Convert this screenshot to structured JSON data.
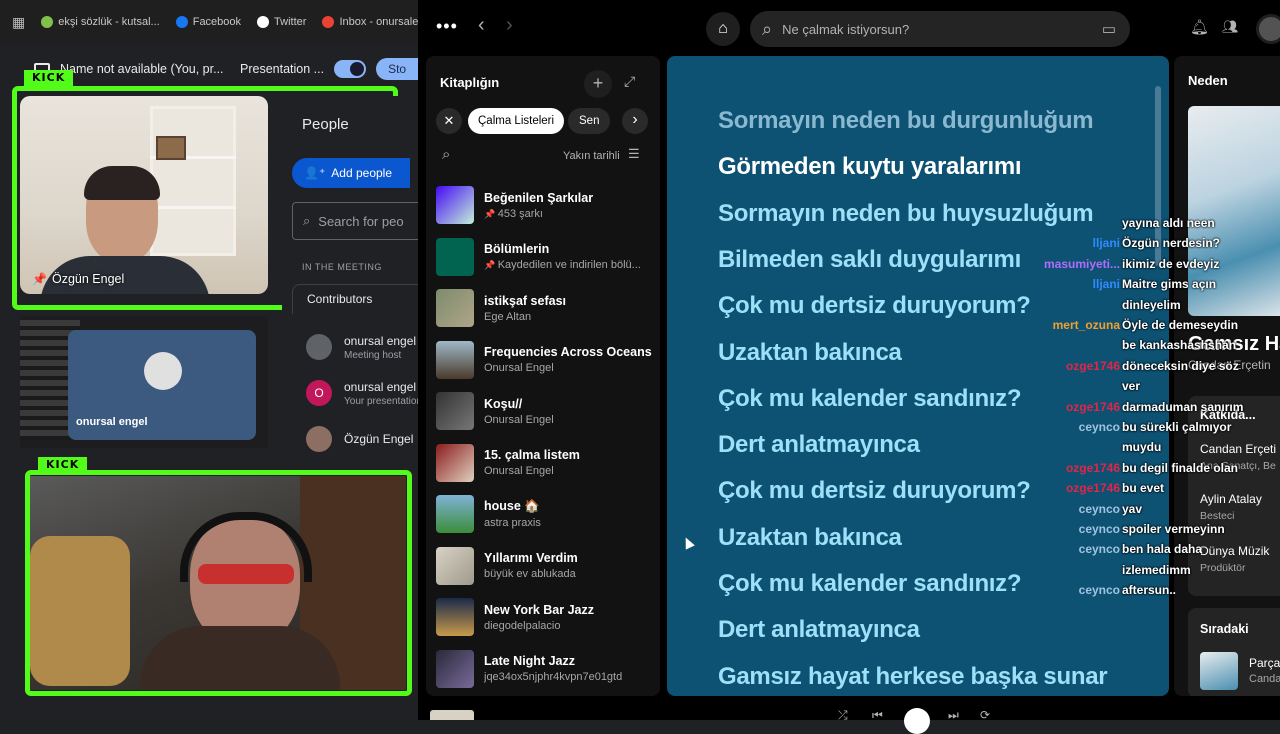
{
  "bookmarks": [
    {
      "label": "ekşi sözlük - kutsal...",
      "color": "#81c14b"
    },
    {
      "label": "Facebook",
      "color": "#1877f2"
    },
    {
      "label": "Twitter",
      "color": "#ffffff"
    },
    {
      "label": "Inbox - onursalenge...",
      "color": "#ea4335"
    }
  ],
  "meet": {
    "presenter_text": "Name not available (You, pr...",
    "presentation_label": "Presentation ...",
    "stop_label": "Sto",
    "kick_label": "KICK",
    "cam1_name": "Özgün Engel",
    "people_title": "People",
    "add_people": "Add people",
    "search_placeholder": "Search for peo",
    "in_meeting": "IN THE MEETING",
    "contributors": "Contributors",
    "participants": [
      {
        "name": "onursal engel",
        "role": "Meeting host",
        "avatar_color": "#5f6368"
      },
      {
        "name": "onursal engel",
        "role": "Your presentation",
        "avatar_color": "#c2185b",
        "initial": "O"
      },
      {
        "name": "Özgün Engel",
        "role": "",
        "avatar_color": "#8d6e63"
      }
    ],
    "tile_name": "onursal engel"
  },
  "spotify": {
    "search_placeholder": "Ne çalmak istiyorsun?",
    "library_title": "Kitaplığın",
    "filters": [
      "Çalma Listeleri",
      "Sen"
    ],
    "sort_label": "Yakın tarihli",
    "items": [
      {
        "title": "Beğenilen Şarkılar",
        "sub": "453 şarkı",
        "pinned": true,
        "thumb": "linear-gradient(135deg,#450af5,#c4efd9)"
      },
      {
        "title": "Bölümlerin",
        "sub": "Kaydedilen ve indirilen bölü...",
        "pinned": true,
        "thumb": "#006450"
      },
      {
        "title": "istikşaf sefası",
        "sub": "Ege Altan",
        "pinned": false,
        "thumb": "linear-gradient(135deg,#7d8c6b,#b0a58a)"
      },
      {
        "title": "Frequencies Across Oceans",
        "sub": "Onursal Engel",
        "pinned": false,
        "thumb": "linear-gradient(180deg,#9fb8c8,#4a3a2a)"
      },
      {
        "title": "Koşu//",
        "sub": "Onursal Engel",
        "pinned": false,
        "thumb": "linear-gradient(135deg,#333,#777)"
      },
      {
        "title": "15. çalma listem",
        "sub": "Onursal Engel",
        "pinned": false,
        "thumb": "linear-gradient(135deg,#8a1c1c,#e0d0c0)"
      },
      {
        "title": "house 🏠",
        "sub": "astra praxis",
        "pinned": false,
        "thumb": "linear-gradient(180deg,#7fb3d5,#3c8d3c)"
      },
      {
        "title": "Yıllarımı Verdim",
        "sub": "büyük ev ablukada",
        "pinned": false,
        "thumb": "linear-gradient(135deg,#d8d2c4,#9e9a8c)"
      },
      {
        "title": "New York Bar Jazz",
        "sub": "diegodelpalacio",
        "pinned": false,
        "thumb": "linear-gradient(180deg,#1a2a4a,#c89a4a)"
      },
      {
        "title": "Late Night Jazz",
        "sub": "jqe34ox5njphr4kvpn7e01gtd",
        "pinned": false,
        "thumb": "linear-gradient(135deg,#2a2a3a,#7a6a9a)"
      }
    ],
    "lyrics": [
      {
        "text": "Sormayın neden bu durgunluğum",
        "state": "past"
      },
      {
        "text": "Görmeden kuytu yaralarımı",
        "state": "current"
      },
      {
        "text": "Sormayın neden bu huysuzluğum",
        "state": "next"
      },
      {
        "text": "Bilmeden saklı duygularımı",
        "state": "next"
      },
      {
        "text": "Çok mu dertsiz duruyorum?",
        "state": "next"
      },
      {
        "text": "Uzaktan bakınca",
        "state": "next"
      },
      {
        "text": "Çok mu kalender sandınız?",
        "state": "next"
      },
      {
        "text": "Dert anlatmayınca",
        "state": "next"
      },
      {
        "text": "Çok mu dertsiz duruyorum?",
        "state": "next"
      },
      {
        "text": "Uzaktan bakınca",
        "state": "next"
      },
      {
        "text": "Çok mu kalender sandınız?",
        "state": "next"
      },
      {
        "text": "Dert anlatmayınca",
        "state": "next"
      },
      {
        "text": "Gamsız hayat herkese başka sunar",
        "state": "next"
      }
    ],
    "right": {
      "heading": "Neden",
      "song_title": "Gamsız Ha",
      "song_artist": "Candan Erçetin",
      "credits_title": "Katkıda...",
      "credits": [
        {
          "name": "Candan Erçeti",
          "role": "Ana Sanatçı, Be"
        },
        {
          "name": "Aylin Atalay",
          "role": "Besteci"
        },
        {
          "name": "Dünya Müzik",
          "role": "Prodüktör"
        }
      ],
      "queue_title": "Sıradaki",
      "queue_item": {
        "title": "Parça",
        "artist": "Canda"
      }
    }
  },
  "chat": [
    {
      "user": "",
      "text": "yayına aldı neen",
      "color": "#b06cff"
    },
    {
      "user": "lljani",
      "text": "Özgün nerdesin?",
      "color": "#2f8bff"
    },
    {
      "user": "masumiyeti...",
      "text": "ikimiz de evdeyiz",
      "color": "#b06cff"
    },
    {
      "user": "lljani",
      "text": "Maitre gims açın",
      "color": "#2f8bff"
    },
    {
      "user": "",
      "text": "dinleyelim",
      "color": "#2f8bff"
    },
    {
      "user": "mert_ozuna",
      "text": "Öyle de demeseydin",
      "color": "#f0a030"
    },
    {
      "user": "",
      "text": "be kankashashshan",
      "color": "#f0a030"
    },
    {
      "user": "ozge1746",
      "text": "döneceksin diye söz",
      "color": "#e0264a"
    },
    {
      "user": "",
      "text": "ver",
      "color": "#e0264a"
    },
    {
      "user": "ozge1746",
      "text": "darmaduman sanırım",
      "color": "#e0264a"
    },
    {
      "user": "ceynco",
      "text": "bu sürekli çalmıyor",
      "color": "#9fc4e0"
    },
    {
      "user": "",
      "text": "muydu",
      "color": "#9fc4e0"
    },
    {
      "user": "ozge1746",
      "text": "bu degil finalde olan",
      "color": "#e0264a"
    },
    {
      "user": "ozge1746",
      "text": "bu evet",
      "color": "#e0264a"
    },
    {
      "user": "ceynco",
      "text": "yav",
      "color": "#9fc4e0"
    },
    {
      "user": "ceynco",
      "text": "spoiler vermeyinn",
      "color": "#9fc4e0"
    },
    {
      "user": "ceynco",
      "text": "ben hala daha",
      "color": "#9fc4e0"
    },
    {
      "user": "",
      "text": "izlemedimm",
      "color": "#9fc4e0"
    },
    {
      "user": "ceynco",
      "text": "aftersun..",
      "color": "#9fc4e0"
    }
  ]
}
